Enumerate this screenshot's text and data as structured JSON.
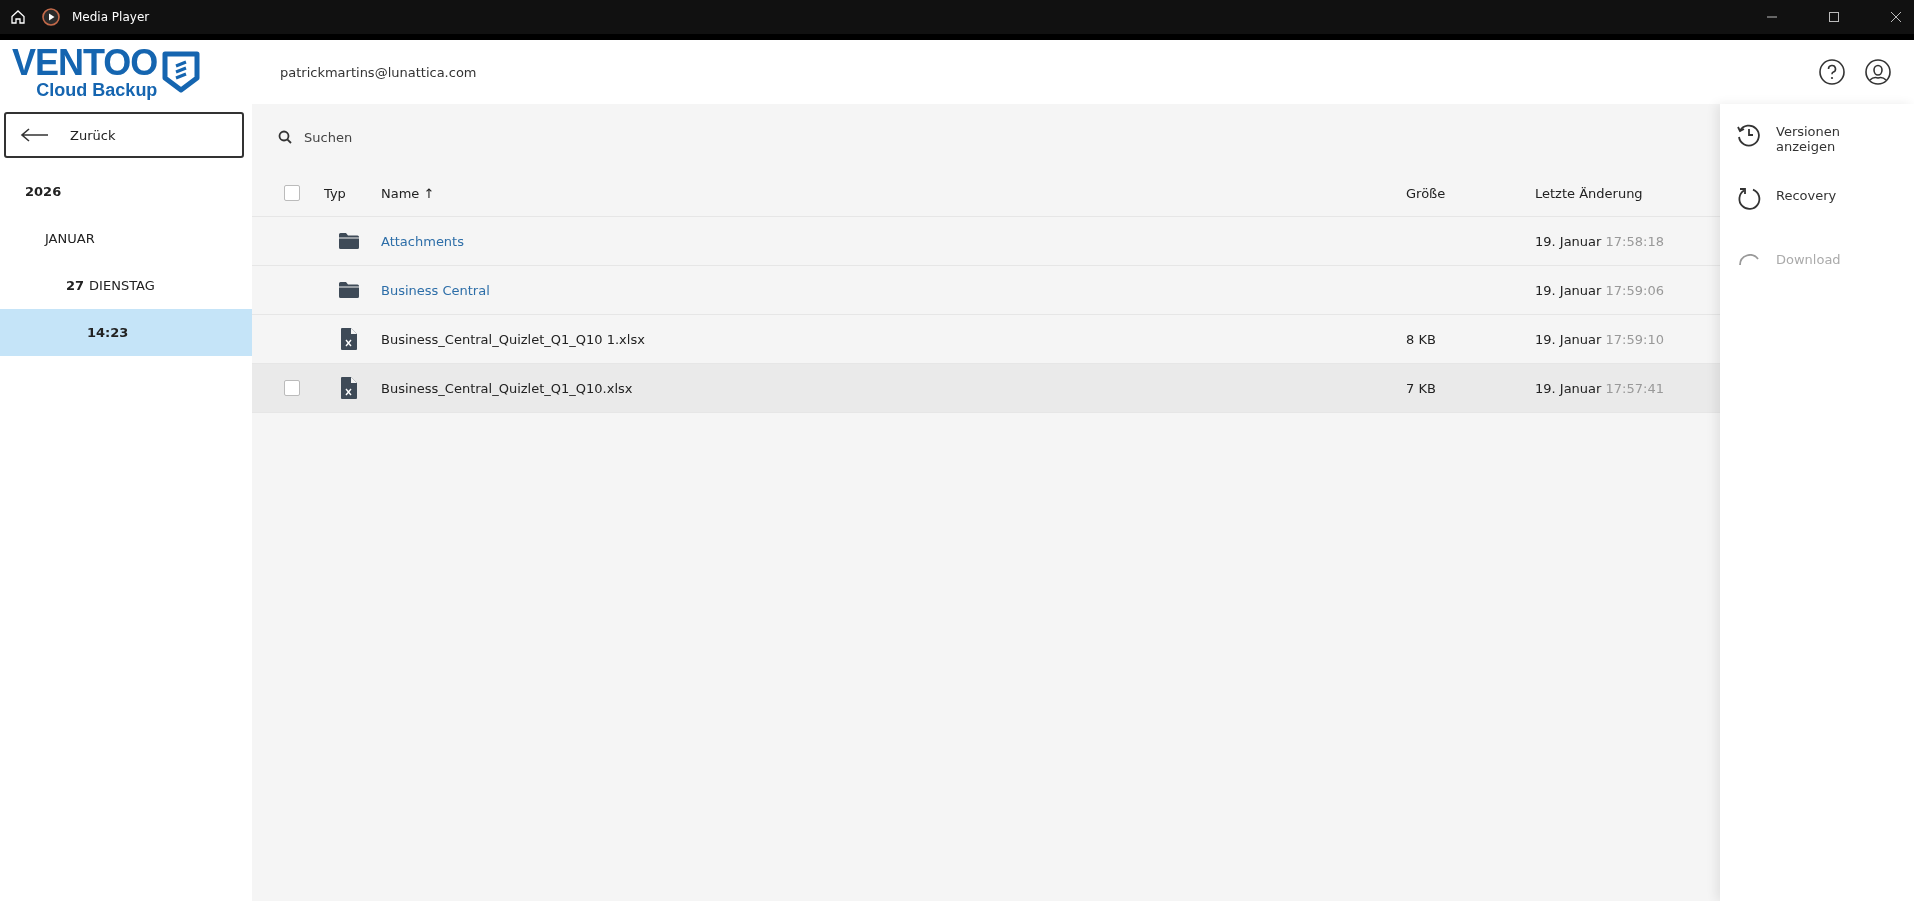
{
  "window": {
    "title": "Media Player"
  },
  "logo": {
    "brand": "VENTOO",
    "product": "Cloud Backup"
  },
  "header": {
    "account": "patrickmartins@lunattica.com"
  },
  "sidebar": {
    "back_label": "Zurück",
    "tree": [
      {
        "label": "2026",
        "selected": false,
        "children": [
          {
            "label": "JANUAR",
            "selected": false,
            "children": [
              {
                "label_number": "27",
                "label": "DIENSTAG",
                "selected": false,
                "children": [
                  {
                    "label": "14:23",
                    "selected": true
                  }
                ]
              }
            ]
          }
        ]
      }
    ]
  },
  "search": {
    "placeholder": "Suchen"
  },
  "table": {
    "select_all_checked": false,
    "columns": [
      "Typ",
      "Name ↑",
      "Größe",
      "Letzte Änderung"
    ],
    "rows": [
      {
        "kind": "folder",
        "name": "Attachments",
        "size": "",
        "date": "19. Januar",
        "time": "17:58:18",
        "hovered": false
      },
      {
        "kind": "folder",
        "name": "Business Central",
        "size": "",
        "date": "19. Januar",
        "time": "17:59:06",
        "hovered": false
      },
      {
        "kind": "file",
        "name": "Business_Central_Quizlet_Q1_Q10 1.xlsx",
        "size": "8 KB",
        "date": "19. Januar",
        "time": "17:59:10",
        "hovered": false
      },
      {
        "kind": "file",
        "name": "Business_Central_Quizlet_Q1_Q10.xlsx",
        "size": "7 KB",
        "date": "19. Januar",
        "time": "17:57:41",
        "hovered": true,
        "checked": false
      }
    ]
  },
  "actions": [
    {
      "kind": "versions",
      "label": "Versionen anzeigen",
      "disabled": false
    },
    {
      "kind": "recovery",
      "label": "Recovery",
      "disabled": false
    },
    {
      "kind": "download",
      "label": "Download",
      "disabled": true
    }
  ]
}
